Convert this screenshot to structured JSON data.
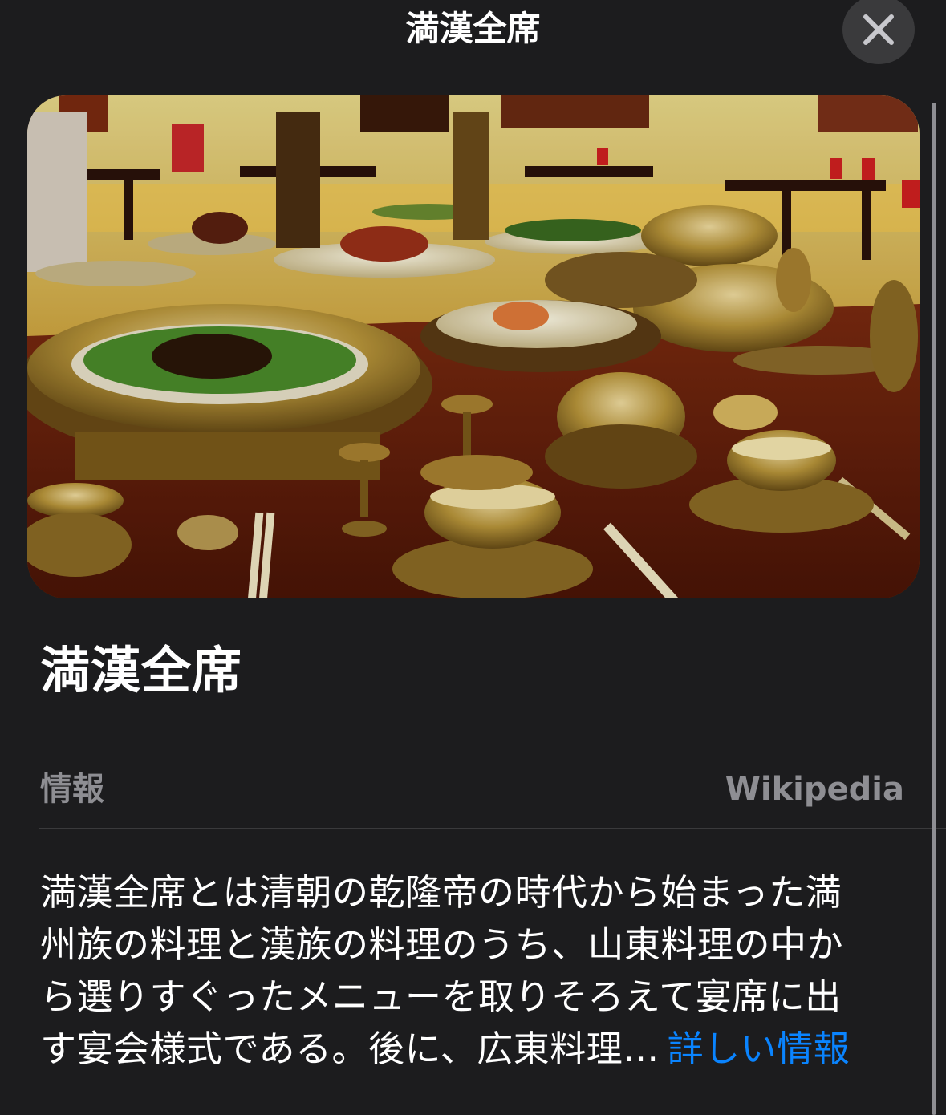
{
  "header": {
    "title": "満漢全席",
    "close_icon": "close-icon"
  },
  "hero_image": {
    "description_icon": "photo-of-banquet-table"
  },
  "entry": {
    "title": "満漢全席"
  },
  "info_section": {
    "label": "情報",
    "source": "Wikipedia",
    "description_lines": [
      "満漢全席とは清朝の乾隆帝の時代から始まった満",
      "州族の料理と漢族の料理のうち、山東料理の中か",
      "ら選りすぐったメニューを取りそろえて宴席に出",
      "す宴会様式である。後に、広東料理…"
    ],
    "more_link": "詳しい情報"
  },
  "colors": {
    "background": "#1c1c1e",
    "secondary_text": "#8e8e93",
    "link": "#0a84ff"
  }
}
